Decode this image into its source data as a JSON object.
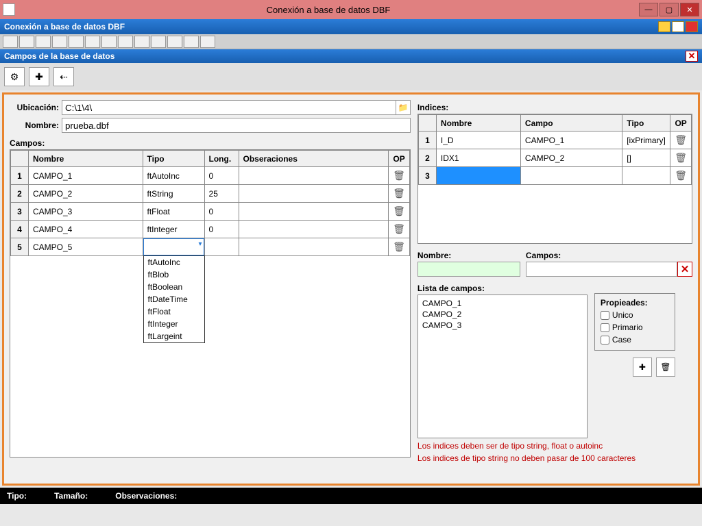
{
  "window": {
    "title": "Conexión a base de datos DBF"
  },
  "mdi": {
    "title": "Conexión a base de datos DBF",
    "subtitle": "Campos de la base de datos"
  },
  "labels": {
    "ubicacion": "Ubicación:",
    "nombre": "Nombre:",
    "campos": "Campos:",
    "indices": "Indices:",
    "nombre2": "Nombre:",
    "campos2": "Campos:",
    "lista": "Lista de campos:",
    "props": "Propieades:"
  },
  "form": {
    "ubicacion": "C:\\1\\4\\",
    "nombre": "prueba.dbf"
  },
  "campos_headers": {
    "nombre": "Nombre",
    "tipo": "Tipo",
    "long": "Long.",
    "obs": "Obseraciones",
    "op": "OP"
  },
  "campos_rows": [
    {
      "n": "1",
      "nombre": "CAMPO_1",
      "tipo": "ftAutoInc",
      "long": "0",
      "obs": ""
    },
    {
      "n": "2",
      "nombre": "CAMPO_2",
      "tipo": "ftString",
      "long": "25",
      "obs": ""
    },
    {
      "n": "3",
      "nombre": "CAMPO_3",
      "tipo": "ftFloat",
      "long": "0",
      "obs": ""
    },
    {
      "n": "4",
      "nombre": "CAMPO_4",
      "tipo": "ftInteger",
      "long": "0",
      "obs": ""
    },
    {
      "n": "5",
      "nombre": "CAMPO_5",
      "tipo": "",
      "long": "",
      "obs": ""
    }
  ],
  "tipo_options": [
    "ftAutoInc",
    "ftBlob",
    "ftBoolean",
    "ftDateTime",
    "ftFloat",
    "ftInteger",
    "ftLargeint"
  ],
  "indices_headers": {
    "nombre": "Nombre",
    "campo": "Campo",
    "tipo": "Tipo",
    "op": "OP"
  },
  "indices_rows": [
    {
      "n": "1",
      "nombre": "I_D",
      "campo": "CAMPO_1",
      "tipo": "[ixPrimary]"
    },
    {
      "n": "2",
      "nombre": "IDX1",
      "campo": "CAMPO_2",
      "tipo": "[]"
    },
    {
      "n": "3",
      "nombre": "",
      "campo": "",
      "tipo": ""
    }
  ],
  "idx_form": {
    "nombre": "",
    "campos": ""
  },
  "lista_campos": [
    "CAMPO_1",
    "CAMPO_2",
    "CAMPO_3"
  ],
  "props": {
    "unico": "Unico",
    "primario": "Primario",
    "case": "Case"
  },
  "warnings": {
    "a": "Los indices deben ser de tipo string, float o autoinc",
    "b": "Los indices de tipo string no deben pasar de 100 caracteres"
  },
  "status": {
    "tipo": "Tipo:",
    "tam": "Tamaño:",
    "obs": "Observaciones:"
  }
}
